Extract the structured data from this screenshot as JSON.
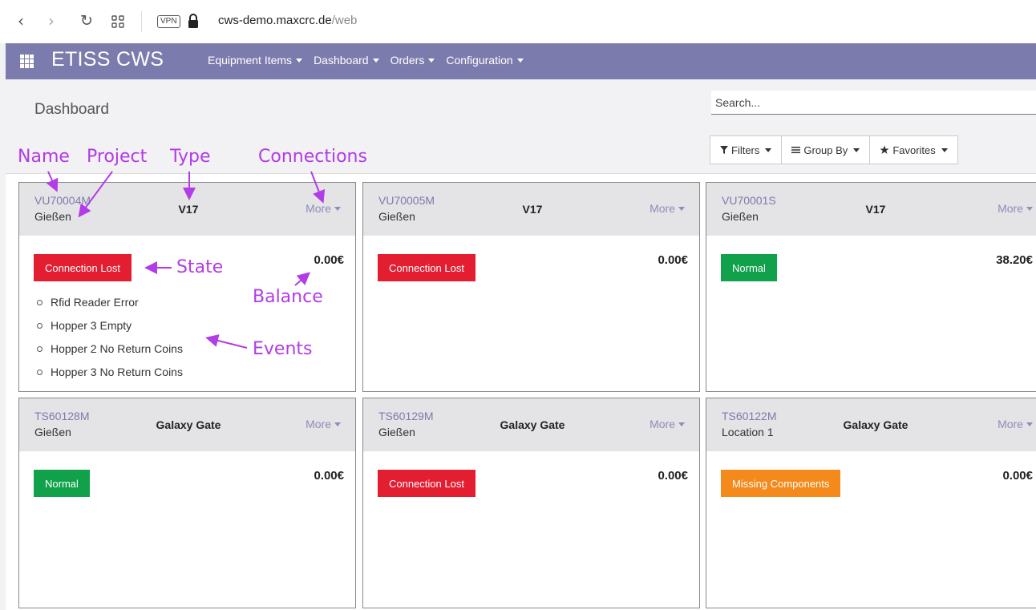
{
  "browser": {
    "back_glyph": "‹",
    "forward_glyph": "›",
    "reload_glyph": "↻",
    "vpn_label": "VPN",
    "url_host": "cws-demo.maxcrc.de",
    "url_path": "/web"
  },
  "navbar": {
    "brand": "ETISS CWS",
    "menu": [
      {
        "label": "Equipment Items"
      },
      {
        "label": "Dashboard"
      },
      {
        "label": "Orders"
      },
      {
        "label": "Configuration"
      }
    ],
    "color": "#7c7bad"
  },
  "control_panel": {
    "breadcrumb": "Dashboard",
    "search_placeholder": "Search...",
    "filters_label": "Filters",
    "group_by_label": "Group By",
    "favorites_label": "Favorites"
  },
  "annotations": {
    "name": "Name",
    "project": "Project",
    "type": "Type",
    "connections": "Connections",
    "state": "State",
    "balance": "Balance",
    "events": "Events",
    "color": "#b23ce8"
  },
  "state_colors": {
    "Connection Lost": "#e41e31",
    "Normal": "#10a14a",
    "Missing Components": "#f48a1c"
  },
  "cards": [
    {
      "name": "VU70004M",
      "project": "Gießen",
      "type": "V17",
      "more_label": "More",
      "state": "Connection Lost",
      "balance": "0.00€",
      "events": [
        "Rfid Reader Error",
        "Hopper 3 Empty",
        "Hopper 2 No Return Coins",
        "Hopper 3 No Return Coins"
      ]
    },
    {
      "name": "VU70005M",
      "project": "Gießen",
      "type": "V17",
      "more_label": "More",
      "state": "Connection Lost",
      "balance": "0.00€",
      "events": []
    },
    {
      "name": "VU70001S",
      "project": "Gießen",
      "type": "V17",
      "more_label": "More",
      "state": "Normal",
      "balance": "38.20€",
      "events": []
    },
    {
      "name": "TS60128M",
      "project": "Gießen",
      "type": "Galaxy Gate",
      "more_label": "More",
      "state": "Normal",
      "balance": "0.00€",
      "events": []
    },
    {
      "name": "TS60129M",
      "project": "Gießen",
      "type": "Galaxy Gate",
      "more_label": "More",
      "state": "Connection Lost",
      "balance": "0.00€",
      "events": []
    },
    {
      "name": "TS60122M",
      "project": "Location 1",
      "type": "Galaxy Gate",
      "more_label": "More",
      "state": "Missing Components",
      "balance": "0.00€",
      "events": []
    }
  ]
}
